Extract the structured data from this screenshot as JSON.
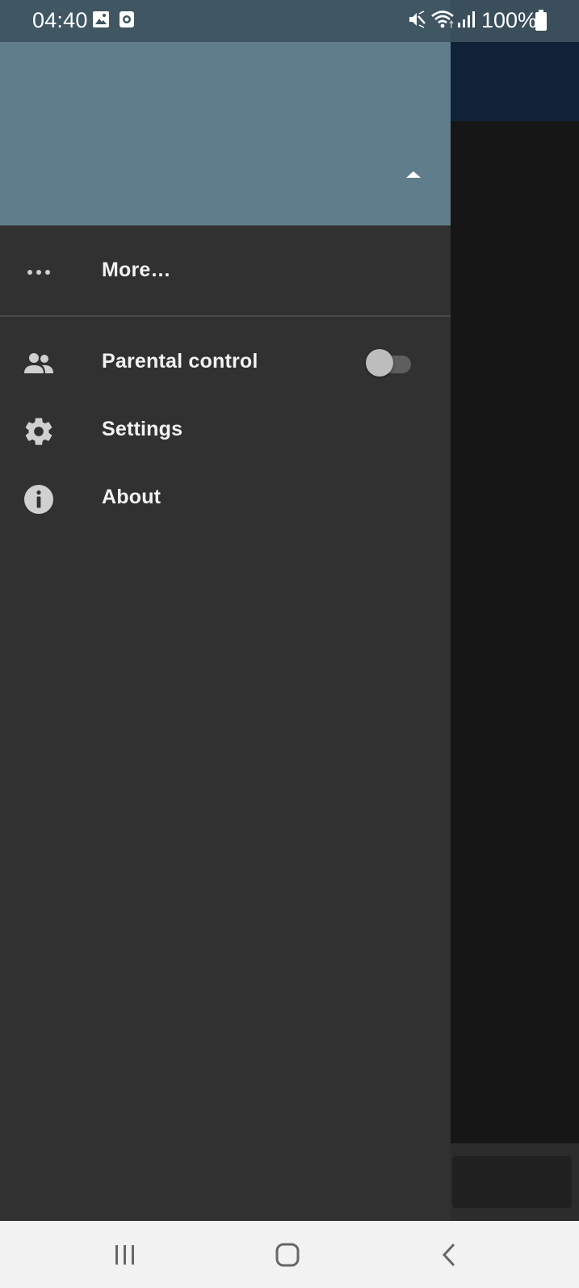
{
  "status_bar": {
    "time": "04:40",
    "battery": "100%",
    "icons": [
      "gallery-icon",
      "screen-recorder-icon",
      "mute-icon",
      "wifi-icon",
      "signal-icon",
      "battery-icon"
    ]
  },
  "drawer": {
    "header": {
      "background_color": "#607d8b",
      "toggle_icon": "arrow-up-icon"
    },
    "items": [
      {
        "label": "More…",
        "icon": "more-horizontal-icon"
      },
      {
        "label": "Parental control",
        "icon": "people-icon",
        "toggle": {
          "state": "off"
        }
      },
      {
        "label": "Settings",
        "icon": "gear-icon"
      },
      {
        "label": "About",
        "icon": "info-icon"
      }
    ]
  },
  "nav_bar": {
    "buttons": [
      "recent-apps-icon",
      "home-icon",
      "back-icon"
    ]
  }
}
